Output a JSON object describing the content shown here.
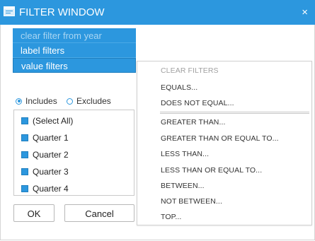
{
  "window": {
    "title": "FILTER WINDOW",
    "close_glyph": "×",
    "accent_color": "#2c97de"
  },
  "filter_types": [
    {
      "label": "clear filter from year",
      "state": "disabled"
    },
    {
      "label": "label filters",
      "state": "normal"
    },
    {
      "label": "value filters",
      "state": "active"
    }
  ],
  "mode": {
    "includes_label": "Includes",
    "excludes_label": "Excludes",
    "selected": "Includes"
  },
  "values": [
    {
      "label": "(Select All)",
      "checked": true
    },
    {
      "label": "Quarter 1",
      "checked": true
    },
    {
      "label": "Quarter 2",
      "checked": true
    },
    {
      "label": "Quarter 3",
      "checked": true
    },
    {
      "label": "Quarter 4",
      "checked": true
    }
  ],
  "buttons": {
    "ok": "OK",
    "cancel": "Cancel"
  },
  "conditions": {
    "clear": "CLEAR FILTERS",
    "equals": "EQUALS...",
    "not_equal": "DOES NOT EQUAL...",
    "greater": "GREATER THAN...",
    "greater_equal": "GREATER THAN OR EQUAL TO...",
    "less": "LESS THAN...",
    "less_equal": "LESS THAN OR EQUAL TO...",
    "between": "BETWEEN...",
    "not_between": "NOT BETWEEN...",
    "top": "TOP..."
  }
}
